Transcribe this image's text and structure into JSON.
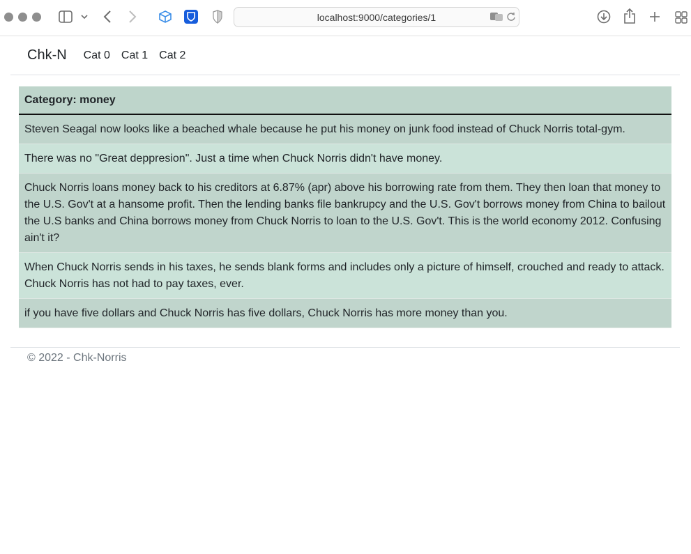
{
  "browser": {
    "url": "localhost:9000/categories/1"
  },
  "nav": {
    "brand": "Chk-N",
    "links": [
      "Cat 0",
      "Cat 1",
      "Cat 2"
    ]
  },
  "category": {
    "header": "Category: money",
    "jokes": [
      "Steven Seagal now looks like a beached whale because he put his money on junk food instead of Chuck Norris total-gym.",
      "There was no \"Great deppresion\". Just a time when Chuck Norris didn't have money.",
      "Chuck Norris loans money back to his creditors at 6.87% (apr) above his borrowing rate from them. They then loan that money to the U.S. Gov't at a hansome profit. Then the lending banks file bankrupcy and the U.S. Gov't borrows money from China to bailout the U.S banks and China borrows money from Chuck Norris to loan to the U.S. Gov't. This is the world economy 2012. Confusing ain't it?",
      "When Chuck Norris sends in his taxes, he sends blank forms and includes only a picture of himself, crouched and ready to attack. Chuck Norris has not had to pay taxes, ever.",
      "if you have five dollars and Chuck Norris has five dollars, Chuck Norris has more money than you."
    ]
  },
  "footer": {
    "text": "© 2022 - Chk-Norris"
  }
}
